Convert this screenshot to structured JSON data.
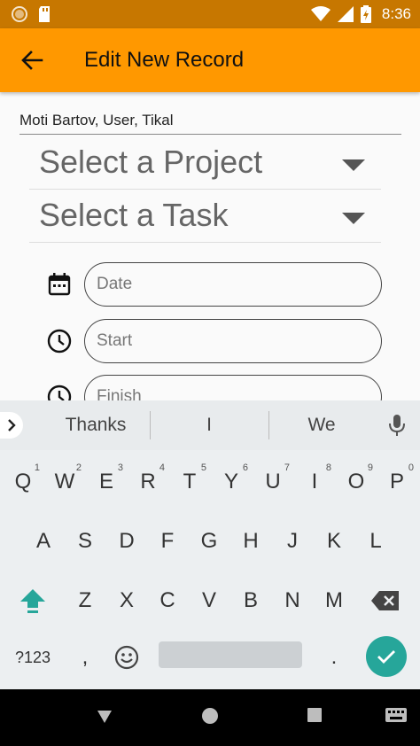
{
  "status_bar": {
    "time": "8:36",
    "icons": [
      "notification-dot-icon",
      "sd-card-icon",
      "wifi-icon",
      "signal-icon",
      "battery-charging-icon"
    ]
  },
  "app_bar": {
    "title": "Edit New Record",
    "background": "#ff9800",
    "status_background": "#c77700"
  },
  "form": {
    "user_line": "Moti Bartov, User, Tikal",
    "project_dropdown": "Select a Project",
    "task_dropdown": "Select a Task",
    "date_placeholder": "Date",
    "start_placeholder": "Start",
    "finish_placeholder": "Finish"
  },
  "keyboard": {
    "suggestions": [
      "Thanks",
      "I",
      "We"
    ],
    "row1": [
      {
        "key": "Q",
        "hint": "1"
      },
      {
        "key": "W",
        "hint": "2"
      },
      {
        "key": "E",
        "hint": "3"
      },
      {
        "key": "R",
        "hint": "4"
      },
      {
        "key": "T",
        "hint": "5"
      },
      {
        "key": "Y",
        "hint": "6"
      },
      {
        "key": "U",
        "hint": "7"
      },
      {
        "key": "I",
        "hint": "8"
      },
      {
        "key": "O",
        "hint": "9"
      },
      {
        "key": "P",
        "hint": "0"
      }
    ],
    "row2": [
      "A",
      "S",
      "D",
      "F",
      "G",
      "H",
      "J",
      "K",
      "L"
    ],
    "row3": [
      "Z",
      "X",
      "C",
      "V",
      "B",
      "N",
      "M"
    ],
    "row4": {
      "symbols": "?123",
      "comma": ",",
      "period": "."
    },
    "accent_color": "#26a69a"
  }
}
